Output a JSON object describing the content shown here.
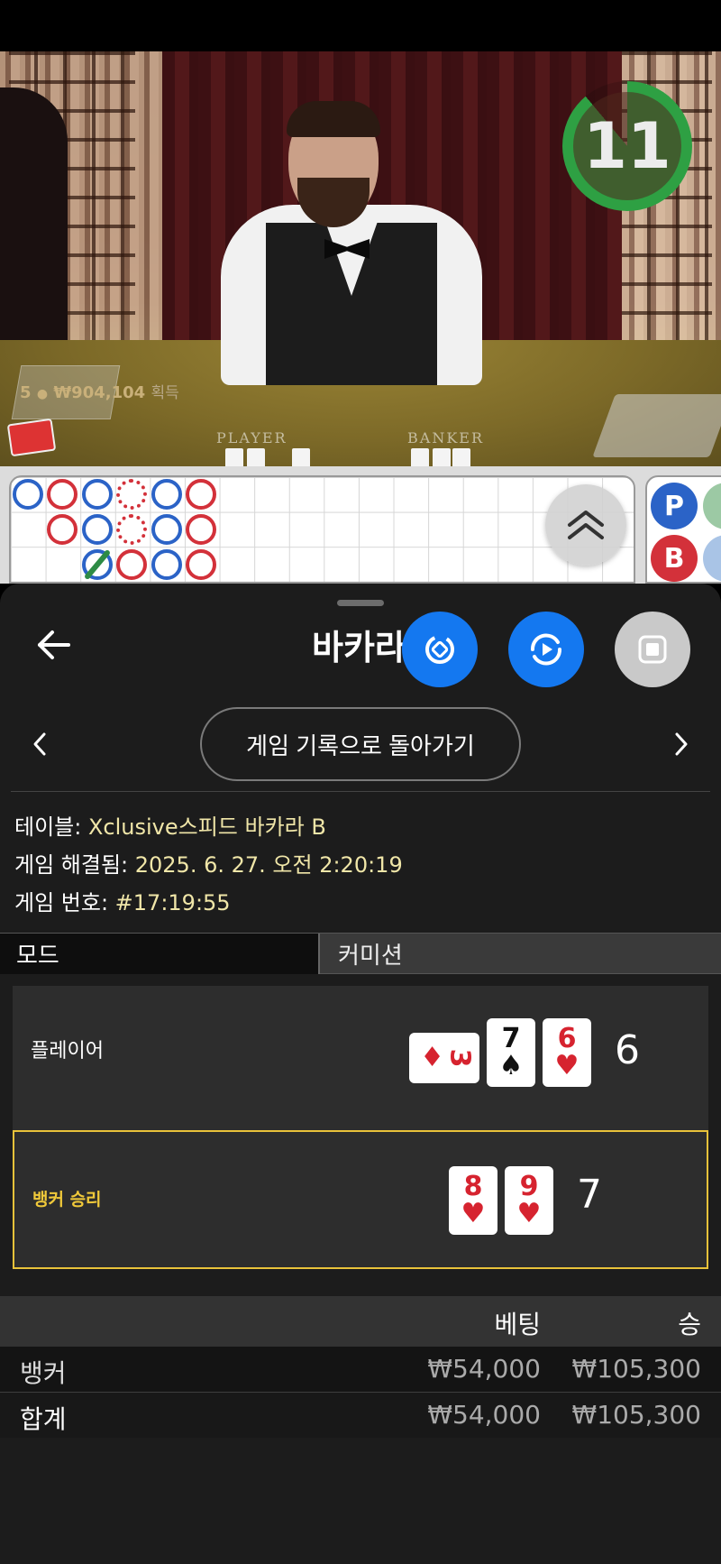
{
  "video": {
    "player_count": "5",
    "winnings_amount": "₩904,104",
    "winnings_suffix": "획득",
    "felt_player": "PLAYER",
    "felt_banker": "BANKER",
    "countdown": "11"
  },
  "roadmap": {
    "side_p": "P",
    "side_b": "B"
  },
  "sheet": {
    "title": "바카라",
    "history_button": "게임 기록으로 돌아가기",
    "info": {
      "table_label": "테이블: ",
      "table_value": "Xclusive스피드 바카라 B",
      "resolved_label": "게임 해결됨: ",
      "resolved_value": "2025. 6. 27. 오전 2:20:19",
      "number_label": "게임 번호: ",
      "number_value": "#17:19:55"
    },
    "tabs": [
      "모드",
      "커미션"
    ],
    "hands": {
      "player_label": "플레이어",
      "player_cards": [
        {
          "rank": "3",
          "suit": "♦",
          "color": "red",
          "orientation": "sideways"
        },
        {
          "rank": "7",
          "suit": "♠",
          "color": "black"
        },
        {
          "rank": "6",
          "suit": "♥",
          "color": "red"
        }
      ],
      "player_score": "6",
      "banker_label": "뱅커 승리",
      "banker_cards": [
        {
          "rank": "8",
          "suit": "♥",
          "color": "red"
        },
        {
          "rank": "9",
          "suit": "♥",
          "color": "red"
        }
      ],
      "banker_score": "7"
    },
    "bets": {
      "header_bet": "베팅",
      "header_win": "승",
      "rows": [
        {
          "name": "뱅커",
          "bet": "₩54,000",
          "win": "₩105,300"
        }
      ],
      "total": {
        "name": "합계",
        "bet": "₩54,000",
        "win": "₩105,300"
      }
    }
  },
  "colors": {
    "accent_blue": "#1478f0",
    "win_gold": "#e8c23a",
    "timer_green": "#2ea043",
    "banker_red": "#d3313a",
    "player_blue": "#2b63c7"
  }
}
